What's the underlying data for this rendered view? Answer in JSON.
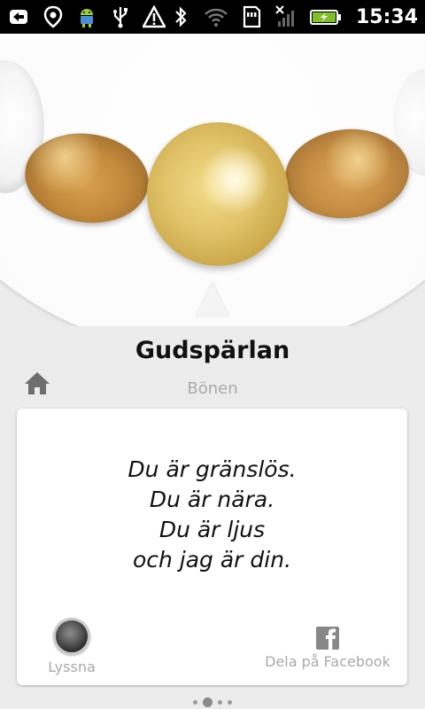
{
  "status_bar": {
    "time": "15:34",
    "left_icons": [
      "usb-debug-icon",
      "location-pin-icon",
      "android-icon",
      "usb-icon",
      "warning-icon"
    ],
    "right_icons": [
      "bluetooth-icon",
      "wifi-icon",
      "sd-card-icon",
      "no-signal-icon",
      "battery-charging-icon"
    ]
  },
  "hero": {
    "beads": [
      "white-bead-left",
      "jasper-bead-left",
      "gold-bead",
      "jasper-bead-right",
      "white-bead-right"
    ]
  },
  "header": {
    "title": "Gudspärlan",
    "subtitle": "Bönen"
  },
  "card": {
    "prayer_lines": [
      "Du är gränslös.",
      "Du är nära.",
      "Du är ljus",
      "och jag är din."
    ],
    "listen_label": "Lyssna",
    "share_label": "Dela på Facebook"
  },
  "pager": {
    "count": 4,
    "active_index": 1
  },
  "colors": {
    "status_bar_bg": "#000000",
    "background": "#ececec",
    "title_text": "#111111",
    "muted_text": "#aaaaaa",
    "card_bg": "#ffffff"
  }
}
